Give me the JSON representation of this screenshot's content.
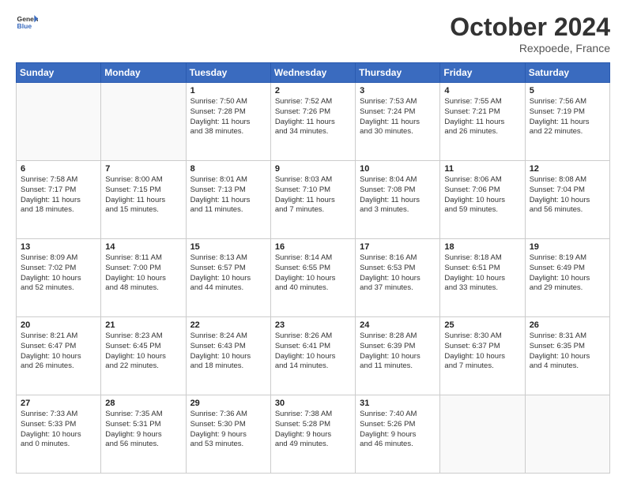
{
  "header": {
    "logo_line1": "General",
    "logo_line2": "Blue",
    "month_year": "October 2024",
    "location": "Rexpoede, France"
  },
  "days_of_week": [
    "Sunday",
    "Monday",
    "Tuesday",
    "Wednesday",
    "Thursday",
    "Friday",
    "Saturday"
  ],
  "weeks": [
    [
      {
        "day": "",
        "lines": []
      },
      {
        "day": "",
        "lines": []
      },
      {
        "day": "1",
        "lines": [
          "Sunrise: 7:50 AM",
          "Sunset: 7:28 PM",
          "Daylight: 11 hours",
          "and 38 minutes."
        ]
      },
      {
        "day": "2",
        "lines": [
          "Sunrise: 7:52 AM",
          "Sunset: 7:26 PM",
          "Daylight: 11 hours",
          "and 34 minutes."
        ]
      },
      {
        "day": "3",
        "lines": [
          "Sunrise: 7:53 AM",
          "Sunset: 7:24 PM",
          "Daylight: 11 hours",
          "and 30 minutes."
        ]
      },
      {
        "day": "4",
        "lines": [
          "Sunrise: 7:55 AM",
          "Sunset: 7:21 PM",
          "Daylight: 11 hours",
          "and 26 minutes."
        ]
      },
      {
        "day": "5",
        "lines": [
          "Sunrise: 7:56 AM",
          "Sunset: 7:19 PM",
          "Daylight: 11 hours",
          "and 22 minutes."
        ]
      }
    ],
    [
      {
        "day": "6",
        "lines": [
          "Sunrise: 7:58 AM",
          "Sunset: 7:17 PM",
          "Daylight: 11 hours",
          "and 18 minutes."
        ]
      },
      {
        "day": "7",
        "lines": [
          "Sunrise: 8:00 AM",
          "Sunset: 7:15 PM",
          "Daylight: 11 hours",
          "and 15 minutes."
        ]
      },
      {
        "day": "8",
        "lines": [
          "Sunrise: 8:01 AM",
          "Sunset: 7:13 PM",
          "Daylight: 11 hours",
          "and 11 minutes."
        ]
      },
      {
        "day": "9",
        "lines": [
          "Sunrise: 8:03 AM",
          "Sunset: 7:10 PM",
          "Daylight: 11 hours",
          "and 7 minutes."
        ]
      },
      {
        "day": "10",
        "lines": [
          "Sunrise: 8:04 AM",
          "Sunset: 7:08 PM",
          "Daylight: 11 hours",
          "and 3 minutes."
        ]
      },
      {
        "day": "11",
        "lines": [
          "Sunrise: 8:06 AM",
          "Sunset: 7:06 PM",
          "Daylight: 10 hours",
          "and 59 minutes."
        ]
      },
      {
        "day": "12",
        "lines": [
          "Sunrise: 8:08 AM",
          "Sunset: 7:04 PM",
          "Daylight: 10 hours",
          "and 56 minutes."
        ]
      }
    ],
    [
      {
        "day": "13",
        "lines": [
          "Sunrise: 8:09 AM",
          "Sunset: 7:02 PM",
          "Daylight: 10 hours",
          "and 52 minutes."
        ]
      },
      {
        "day": "14",
        "lines": [
          "Sunrise: 8:11 AM",
          "Sunset: 7:00 PM",
          "Daylight: 10 hours",
          "and 48 minutes."
        ]
      },
      {
        "day": "15",
        "lines": [
          "Sunrise: 8:13 AM",
          "Sunset: 6:57 PM",
          "Daylight: 10 hours",
          "and 44 minutes."
        ]
      },
      {
        "day": "16",
        "lines": [
          "Sunrise: 8:14 AM",
          "Sunset: 6:55 PM",
          "Daylight: 10 hours",
          "and 40 minutes."
        ]
      },
      {
        "day": "17",
        "lines": [
          "Sunrise: 8:16 AM",
          "Sunset: 6:53 PM",
          "Daylight: 10 hours",
          "and 37 minutes."
        ]
      },
      {
        "day": "18",
        "lines": [
          "Sunrise: 8:18 AM",
          "Sunset: 6:51 PM",
          "Daylight: 10 hours",
          "and 33 minutes."
        ]
      },
      {
        "day": "19",
        "lines": [
          "Sunrise: 8:19 AM",
          "Sunset: 6:49 PM",
          "Daylight: 10 hours",
          "and 29 minutes."
        ]
      }
    ],
    [
      {
        "day": "20",
        "lines": [
          "Sunrise: 8:21 AM",
          "Sunset: 6:47 PM",
          "Daylight: 10 hours",
          "and 26 minutes."
        ]
      },
      {
        "day": "21",
        "lines": [
          "Sunrise: 8:23 AM",
          "Sunset: 6:45 PM",
          "Daylight: 10 hours",
          "and 22 minutes."
        ]
      },
      {
        "day": "22",
        "lines": [
          "Sunrise: 8:24 AM",
          "Sunset: 6:43 PM",
          "Daylight: 10 hours",
          "and 18 minutes."
        ]
      },
      {
        "day": "23",
        "lines": [
          "Sunrise: 8:26 AM",
          "Sunset: 6:41 PM",
          "Daylight: 10 hours",
          "and 14 minutes."
        ]
      },
      {
        "day": "24",
        "lines": [
          "Sunrise: 8:28 AM",
          "Sunset: 6:39 PM",
          "Daylight: 10 hours",
          "and 11 minutes."
        ]
      },
      {
        "day": "25",
        "lines": [
          "Sunrise: 8:30 AM",
          "Sunset: 6:37 PM",
          "Daylight: 10 hours",
          "and 7 minutes."
        ]
      },
      {
        "day": "26",
        "lines": [
          "Sunrise: 8:31 AM",
          "Sunset: 6:35 PM",
          "Daylight: 10 hours",
          "and 4 minutes."
        ]
      }
    ],
    [
      {
        "day": "27",
        "lines": [
          "Sunrise: 7:33 AM",
          "Sunset: 5:33 PM",
          "Daylight: 10 hours",
          "and 0 minutes."
        ]
      },
      {
        "day": "28",
        "lines": [
          "Sunrise: 7:35 AM",
          "Sunset: 5:31 PM",
          "Daylight: 9 hours",
          "and 56 minutes."
        ]
      },
      {
        "day": "29",
        "lines": [
          "Sunrise: 7:36 AM",
          "Sunset: 5:30 PM",
          "Daylight: 9 hours",
          "and 53 minutes."
        ]
      },
      {
        "day": "30",
        "lines": [
          "Sunrise: 7:38 AM",
          "Sunset: 5:28 PM",
          "Daylight: 9 hours",
          "and 49 minutes."
        ]
      },
      {
        "day": "31",
        "lines": [
          "Sunrise: 7:40 AM",
          "Sunset: 5:26 PM",
          "Daylight: 9 hours",
          "and 46 minutes."
        ]
      },
      {
        "day": "",
        "lines": []
      },
      {
        "day": "",
        "lines": []
      }
    ]
  ]
}
